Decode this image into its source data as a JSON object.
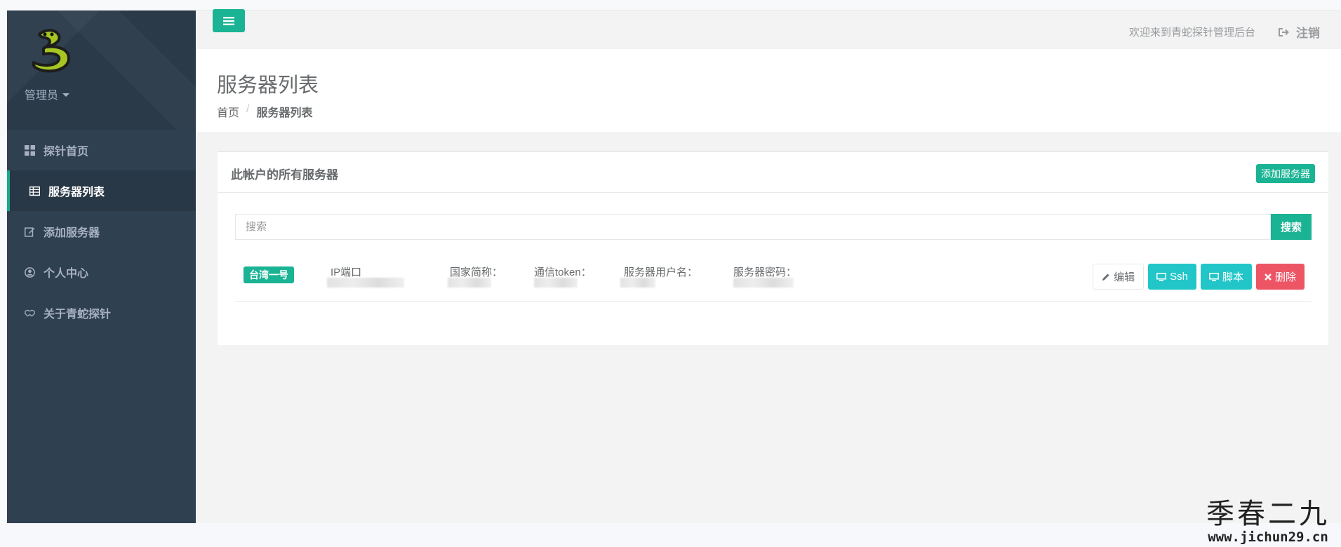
{
  "sidebar": {
    "user_name": "管理员",
    "items": [
      {
        "label": "探针首页",
        "icon": "grid-icon"
      },
      {
        "label": "服务器列表",
        "icon": "table-icon",
        "active": true
      },
      {
        "label": "添加服务器",
        "icon": "edit-icon"
      },
      {
        "label": "个人中心",
        "icon": "user-circle-icon"
      },
      {
        "label": "关于青蛇探针",
        "icon": "handshake-icon"
      }
    ]
  },
  "topbar": {
    "welcome": "欢迎来到青蛇探针管理后台",
    "logout": "注销"
  },
  "heading": {
    "title": "服务器列表",
    "breadcrumb": [
      "首页",
      "服务器列表"
    ]
  },
  "panel": {
    "title": "此帐户的所有服务器",
    "add_button": "添加服务器",
    "search_placeholder": "搜索",
    "search_button": "搜索",
    "rows": [
      {
        "region": "台湾一号",
        "labels": [
          "IP端口",
          "国家简称：",
          "通信token：",
          "服务器用户名：",
          "服务器密码："
        ],
        "actions": {
          "edit": "编辑",
          "ssh": "Ssh",
          "script": "脚本",
          "delete": "删除"
        }
      }
    ]
  },
  "watermark": {
    "title": "季春二九",
    "url": "www.jichun29.cn"
  },
  "colors": {
    "sidebar": "#2f4050",
    "primary": "#1ab394",
    "info": "#23c6c8",
    "danger": "#ed5565"
  }
}
